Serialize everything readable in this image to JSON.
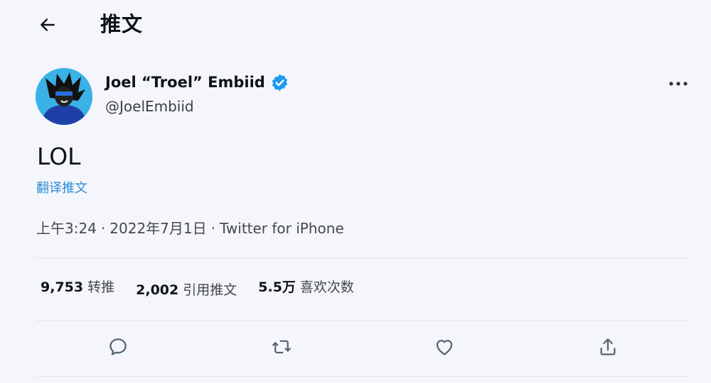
{
  "header": {
    "title": "推文",
    "back_icon": "arrow-left-icon"
  },
  "author": {
    "display_name": "Joel “Troel” Embiid",
    "handle": "@JoelEmbiid",
    "verified_icon": "verified-badge-icon",
    "more_icon": "more-horizontal-icon"
  },
  "tweet": {
    "text": "LOL",
    "translate_label": "翻译推文",
    "time": "上午3:24",
    "date": "2022年7月1日",
    "separator": "·",
    "source": "Twitter for iPhone"
  },
  "stats": {
    "retweets": {
      "count": "9,753",
      "label": "转推"
    },
    "quotes": {
      "count": "2,002",
      "label": "引用推文"
    },
    "likes": {
      "count": "5.5万",
      "label": "喜欢次数"
    }
  },
  "actions": {
    "reply_icon": "reply-icon",
    "retweet_icon": "retweet-icon",
    "like_icon": "heart-icon",
    "share_icon": "share-icon"
  },
  "colors": {
    "background": "#f5f6fb",
    "text": "#0f1419",
    "link": "#2a8bd6",
    "verified": "#1d9bf0",
    "divider": "#e3e5ea",
    "icon": "#536471"
  }
}
